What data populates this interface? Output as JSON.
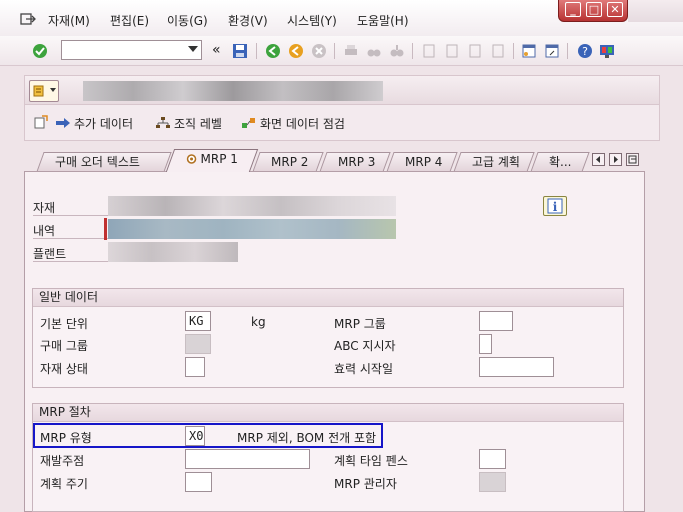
{
  "menu": {
    "items": [
      "자재(M)",
      "편집(E)",
      "이동(G)",
      "환경(V)",
      "시스템(Y)",
      "도움말(H)"
    ]
  },
  "toolbar": {
    "command_value": "",
    "nav_symbol": "«"
  },
  "app_toolbar": {
    "add_data": "추가 데이터",
    "org_level": "조직 레벨",
    "check_screen_data": "화면 데이터 점검"
  },
  "tabs": [
    "구매 오더 텍스트",
    "MRP 1",
    "MRP 2",
    "MRP 3",
    "MRP 4",
    "고급 계획",
    "확..."
  ],
  "header_fields": {
    "material_label": "자재",
    "description_label": "내역",
    "plant_label": "플랜트"
  },
  "general_data": {
    "title": "일반 데이터",
    "base_unit_label": "기본 단위",
    "base_unit_value": "KG",
    "base_unit_text": "kg",
    "mrp_group_label": "MRP 그룹",
    "purchasing_group_label": "구매 그룹",
    "abc_indicator_label": "ABC 지시자",
    "material_status_label": "자재 상태",
    "valid_from_label": "효력 시작일"
  },
  "mrp_procedure": {
    "title": "MRP 절차",
    "mrp_type_label": "MRP 유형",
    "mrp_type_value": "X0",
    "mrp_type_text": "MRP 제외, BOM 전개 포함",
    "reorder_point_label": "재발주점",
    "planning_time_fence_label": "계획 타임 펜스",
    "planning_cycle_label": "계획 주기",
    "mrp_controller_label": "MRP 관리자"
  },
  "colors": {
    "highlight": "#1616c8",
    "window_controls": "#b73232"
  }
}
